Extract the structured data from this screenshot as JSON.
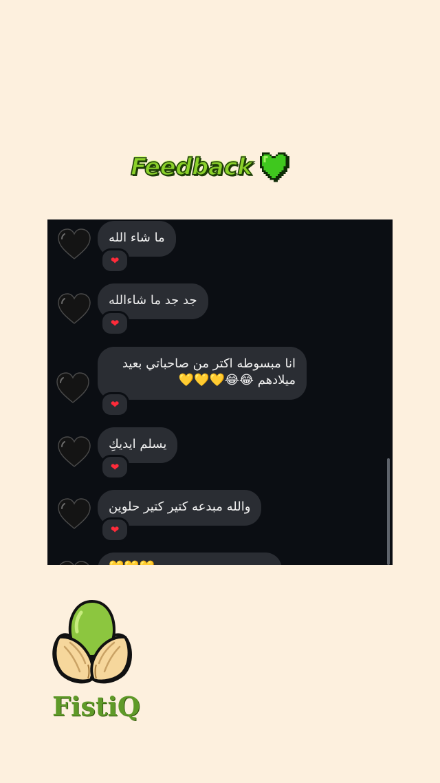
{
  "title": {
    "text": "Feedback",
    "heart_icon": "green-heart-icon",
    "heart_color": "#3fc81e"
  },
  "chat": {
    "background": "#0b0e13",
    "bubble_color": "#2a2d33",
    "messages": [
      {
        "text": "ما شاء الله",
        "reaction": "❤"
      },
      {
        "text": "جد جد ما شاءالله",
        "reaction": "❤"
      },
      {
        "line1": "انا مبسوطه اكتر من صاحباتي بعيد",
        "line2": "ميلادهم 😂😂💛💛💛",
        "reaction": "❤"
      },
      {
        "text": "يسلم ايديكِ",
        "reaction": "❤"
      },
      {
        "text": "والله مبدعه كتير كتير حلوين",
        "reaction": "❤"
      },
      {
        "text": "💛💛💛"
      }
    ],
    "avatar_icon": "black-heart-icon"
  },
  "brand": {
    "name": "FistiQ",
    "logo_icon": "pistachio-logo-icon",
    "color": "#5f9a28"
  }
}
